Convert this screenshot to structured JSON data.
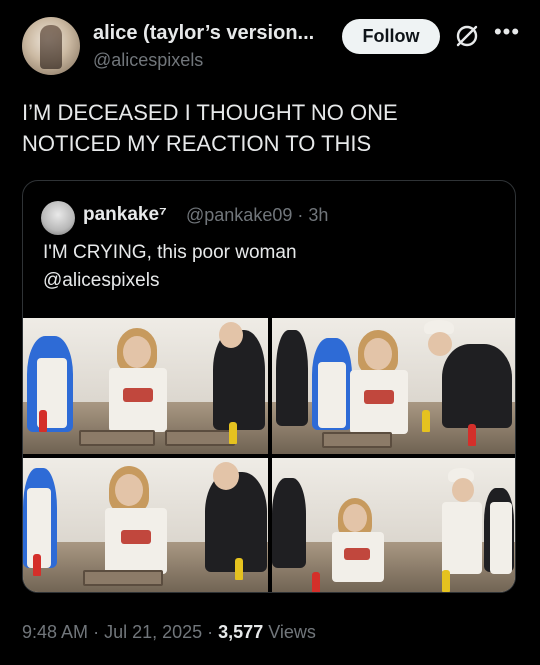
{
  "author": {
    "name": "alice (taylor’s version...",
    "handle": "@alicespixels"
  },
  "actions": {
    "follow_label": "Follow",
    "grok_icon": "grok-icon",
    "more_icon": "more-dots-icon"
  },
  "tweet": {
    "lines": [
      "I’M DECEASED I THOUGHT NO ONE",
      "NOTICED MY REACTION TO THIS"
    ]
  },
  "quote": {
    "name": "pankake⁷",
    "handle": "@pankake09",
    "time": "· 3h",
    "lines": [
      "I'M CRYING, this poor woman",
      "@alicespixels"
    ]
  },
  "meta": {
    "time": "9:48 AM",
    "date": "Jul 21, 2025",
    "views_count": "3,577",
    "views_label": "Views"
  },
  "colors": {
    "background": "#000000",
    "text": "#e7e9ea",
    "secondary": "#71767b",
    "border": "#2f3336",
    "follow_bg": "#eff3f4"
  }
}
